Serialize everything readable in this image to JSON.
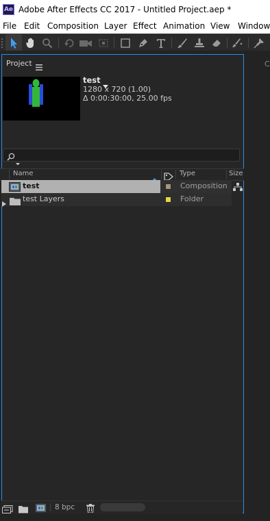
{
  "window": {
    "app_icon_text": "Ae",
    "title": "Adobe After Effects CC 2017 - Untitled Project.aep *"
  },
  "menu": {
    "items": [
      "File",
      "Edit",
      "Composition",
      "Layer",
      "Effect",
      "Animation",
      "View",
      "Window"
    ]
  },
  "toolbar": {
    "tools": [
      "selection-tool",
      "hand-tool",
      "zoom-tool",
      "rotation-tool",
      "camera-tool",
      "pan-behind-tool",
      "rectangle-tool",
      "pen-tool",
      "type-tool",
      "brush-tool",
      "clone-stamp-tool",
      "eraser-tool",
      "roto-brush-tool",
      "puppet-pin-tool"
    ]
  },
  "panel": {
    "tab_label": "Project",
    "right_panel_label": "C"
  },
  "preview": {
    "name": "test",
    "resolution": "1280 x 720 (1.00)",
    "duration": "Δ 0:00:30:00, 25.00 fps"
  },
  "search": {
    "value": "",
    "placeholder": ""
  },
  "columns": {
    "name": "Name",
    "type": "Type",
    "size": "Size"
  },
  "items": [
    {
      "name": "test",
      "type": "Composition",
      "label_color": "#a6957b",
      "selected": true
    },
    {
      "name": "test Layers",
      "type": "Folder",
      "label_color": "#e3d84a",
      "selected": false
    }
  ],
  "footer": {
    "bpc": "8 bpc"
  },
  "colors": {
    "accent": "#2d8ceb",
    "selected_row": "#b1b1b1"
  }
}
